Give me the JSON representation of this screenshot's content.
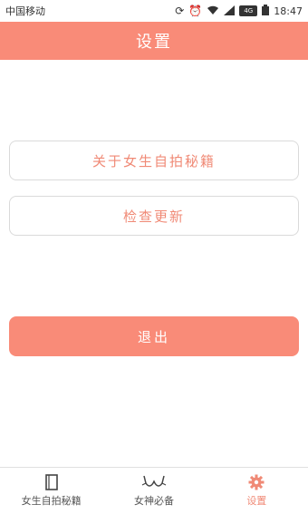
{
  "status_bar": {
    "carrier": "中国移动",
    "network": "4G",
    "time": "18:47"
  },
  "header": {
    "title": "设置"
  },
  "menu": {
    "about_label": "关于女生自拍秘籍",
    "update_label": "检查更新"
  },
  "logout_label": "退出",
  "tabs": [
    {
      "label": "女生自拍秘籍",
      "icon": "notebook-icon"
    },
    {
      "label": "女神必备",
      "icon": "bra-icon"
    },
    {
      "label": "设置",
      "icon": "gear-icon"
    }
  ],
  "colors": {
    "accent": "#f98b78",
    "accent_text": "#f08a76",
    "border": "#dadada"
  }
}
